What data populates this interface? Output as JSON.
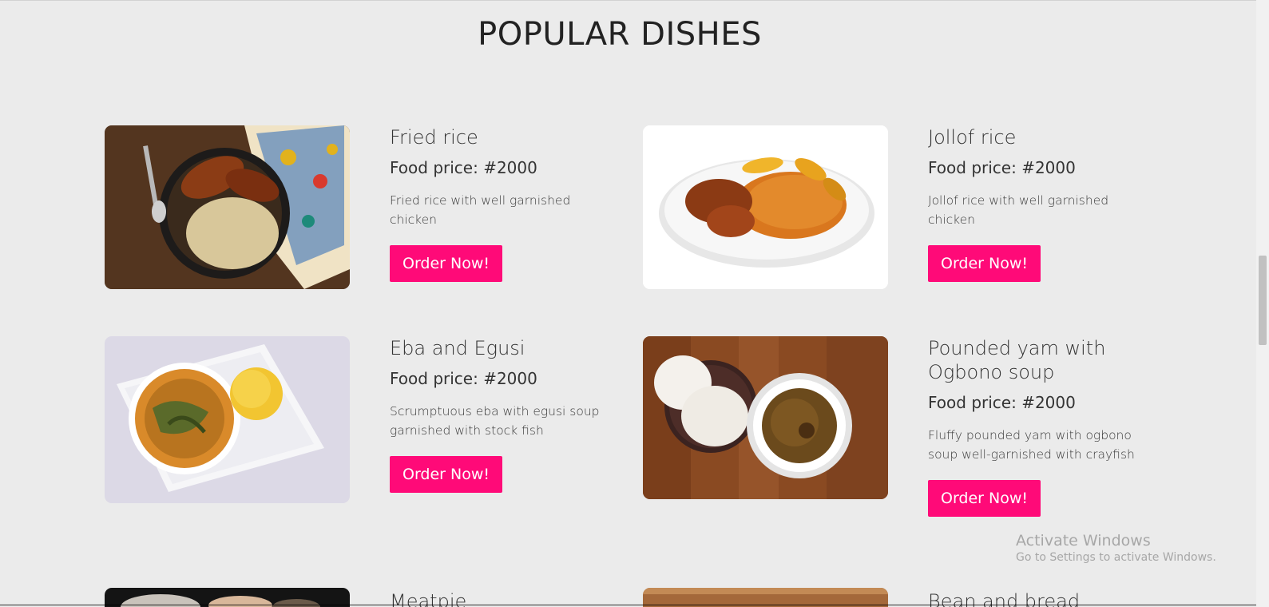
{
  "section": {
    "title": "POPULAR DISHES"
  },
  "dishes": [
    {
      "name": "Fried rice",
      "price": "Food price: #2000",
      "description": "Fried rice with well garnished chicken",
      "button": "Order Now!"
    },
    {
      "name": "Jollof rice",
      "price": "Food price: #2000",
      "description": "Jollof rice with well garnished chicken",
      "button": "Order Now!"
    },
    {
      "name": "Eba and Egusi",
      "price": "Food price: #2000",
      "description": "Scrumptuous eba with egusi soup garnished with stock fish",
      "button": "Order Now!"
    },
    {
      "name": "Pounded yam with Ogbono soup",
      "price": "Food price: #2000",
      "description": "Fluffy pounded yam with ogbono soup well-garnished with crayfish",
      "button": "Order Now!"
    },
    {
      "name": "Meatpie"
    },
    {
      "name": "Bean and bread"
    }
  ],
  "theme": {
    "accent": "#ff0a78",
    "background": "#ebebeb"
  },
  "watermark": {
    "line1": "Activate Windows",
    "line2": "Go to Settings to activate Windows."
  }
}
